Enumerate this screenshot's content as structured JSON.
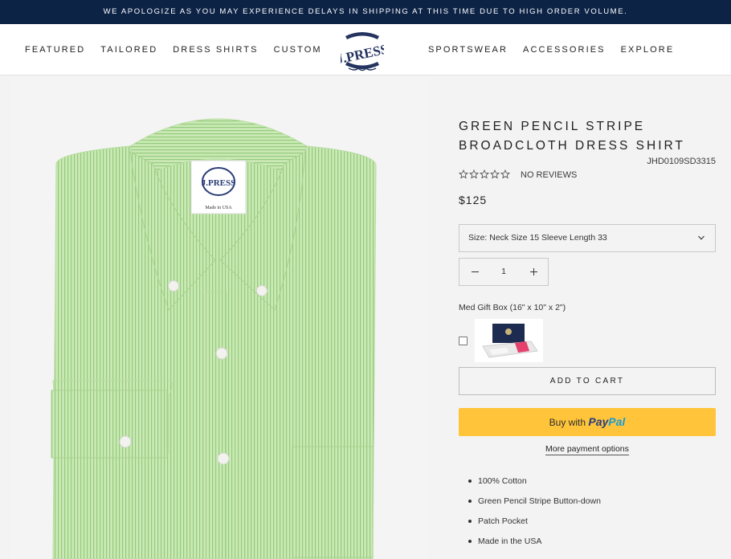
{
  "announcement": "WE APOLOGIZE AS YOU MAY EXPERIENCE DELAYS IN SHIPPING AT THIS TIME DUE TO HIGH ORDER VOLUME.",
  "nav": {
    "left": [
      "FEATURED",
      "TAILORED",
      "DRESS SHIRTS",
      "CUSTOM"
    ],
    "right": [
      "SPORTSWEAR",
      "ACCESSORIES",
      "EXPLORE"
    ]
  },
  "logo": {
    "text": "J.PRESS",
    "color": "#24345f"
  },
  "product": {
    "title": "GREEN PENCIL STRIPE BROADCLOTH DRESS SHIRT",
    "sku": "JHD0109SD3315",
    "rating_stars": 0,
    "reviews_label": "NO REVIEWS",
    "price": "$125",
    "size_select": "Size: Neck Size 15 Sleeve Length 33",
    "quantity": "1",
    "gift_label": "Med Gift Box (16\" x 10\" x 2\")",
    "gift_checked": false,
    "add_to_cart": "ADD TO CART",
    "paypal": {
      "prefix": "Buy with",
      "brand_a": "Pay",
      "brand_b": "Pal"
    },
    "more_payment": "More payment options",
    "features": [
      "100% Cotton",
      "Green Pencil Stripe Button-down",
      "Patch Pocket",
      "Made in the USA"
    ]
  },
  "shirt_label": {
    "brand": "J.PRESS",
    "made_in": "Made in USA"
  },
  "colors": {
    "announce_bg": "#0d2346",
    "paypal_bg": "#ffc439",
    "shirt_green": "#c6e6b0",
    "stripe_green": "#8fc877"
  }
}
